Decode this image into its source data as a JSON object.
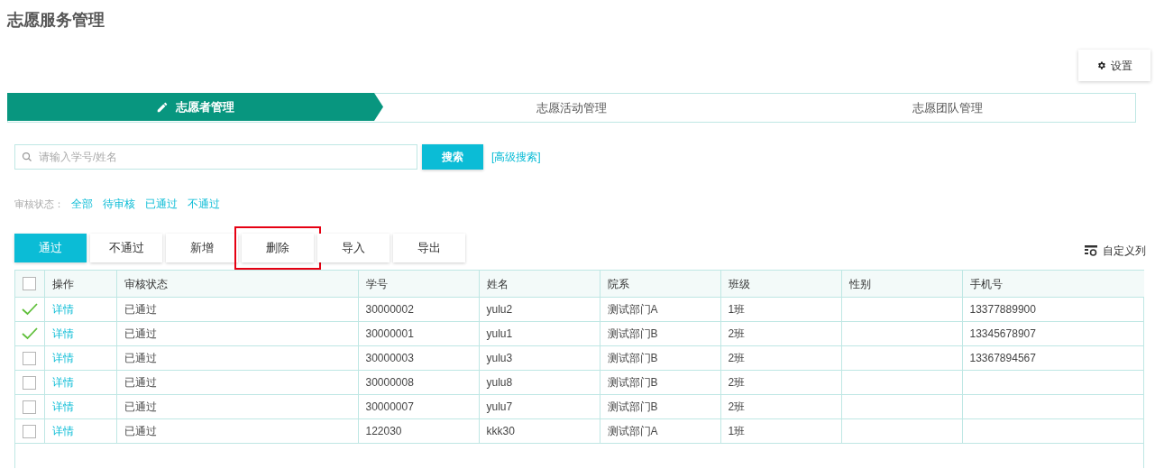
{
  "page_title": "志愿服务管理",
  "settings_button": "设置",
  "steps": [
    {
      "label": "志愿者管理",
      "selected": true
    },
    {
      "label": "志愿活动管理",
      "selected": false
    },
    {
      "label": "志愿团队管理",
      "selected": false
    }
  ],
  "search": {
    "placeholder": "请输入学号/姓名",
    "button": "搜索",
    "advanced_link": "[高级搜索]"
  },
  "status_filter": {
    "label": "审核状态：",
    "options": [
      "全部",
      "待审核",
      "已通过",
      "不通过"
    ]
  },
  "actions": [
    {
      "label": "通过",
      "kind": "primary",
      "highlighted": false
    },
    {
      "label": "不通过",
      "kind": "plain",
      "highlighted": false
    },
    {
      "label": "新增",
      "kind": "plain",
      "highlighted": false
    },
    {
      "label": "删除",
      "kind": "plain",
      "highlighted": true
    },
    {
      "label": "导入",
      "kind": "plain",
      "highlighted": false
    },
    {
      "label": "导出",
      "kind": "plain",
      "highlighted": false
    }
  ],
  "custom_columns": "自定义列",
  "table": {
    "header_checked": false,
    "columns": [
      "操作",
      "审核状态",
      "学号",
      "姓名",
      "院系",
      "班级",
      "性别",
      "手机号"
    ],
    "rows": [
      {
        "checked": true,
        "action": "详情",
        "status": "已通过",
        "id": "30000002",
        "name": "yulu2",
        "dept": "测试部门A",
        "class": "1班",
        "phone": "13377889900"
      },
      {
        "checked": true,
        "action": "详情",
        "status": "已通过",
        "id": "30000001",
        "name": "yulu1",
        "dept": "测试部门B",
        "class": "2班",
        "phone": "13345678907"
      },
      {
        "checked": false,
        "action": "详情",
        "status": "已通过",
        "id": "30000003",
        "name": "yulu3",
        "dept": "测试部门B",
        "class": "2班",
        "phone": "13367894567"
      },
      {
        "checked": false,
        "action": "详情",
        "status": "已通过",
        "id": "30000008",
        "name": "yulu8",
        "dept": "测试部门B",
        "class": "2班"
      },
      {
        "checked": false,
        "action": "详情",
        "status": "已通过",
        "id": "30000007",
        "name": "yulu7",
        "dept": "测试部门B",
        "class": "2班"
      },
      {
        "checked": false,
        "action": "详情",
        "status": "已通过",
        "id": "122030",
        "name": "kkk30",
        "dept": "测试部门A",
        "class": "1班"
      }
    ]
  }
}
